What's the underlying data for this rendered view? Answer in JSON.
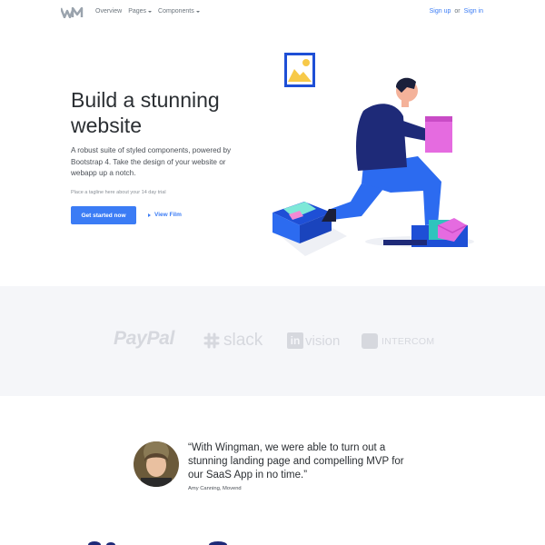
{
  "nav": {
    "logo": "wingman-logo-icon",
    "links": [
      {
        "label": "Overview",
        "has_dropdown": false
      },
      {
        "label": "Pages",
        "has_dropdown": true
      },
      {
        "label": "Components",
        "has_dropdown": true
      }
    ],
    "signup": "Sign up",
    "or": "or",
    "signin": "Sign in"
  },
  "hero": {
    "title": "Build a stunning website",
    "description": "A robust suite of styled components, powered by Bootstrap 4. Take the design of your website or webapp up a notch.",
    "tagline": "Place a tagline here about your 14 day trial",
    "primary_button": "Get started now",
    "secondary_link": "View Film"
  },
  "logos": {
    "paypal": "PayPal",
    "slack": "slack",
    "invision_in": "in",
    "invision_rest": "vision",
    "intercom": "INTERCOM"
  },
  "testimonial": {
    "quote": "“With Wingman, we were able to turn out a stunning landing page and compelling MVP for our SaaS App in no time.”",
    "author": "Amy Canning, Movend"
  },
  "colors": {
    "accent": "#3b7cf5",
    "band": "#f5f6f9",
    "logo_gray": "#d6d8de"
  }
}
